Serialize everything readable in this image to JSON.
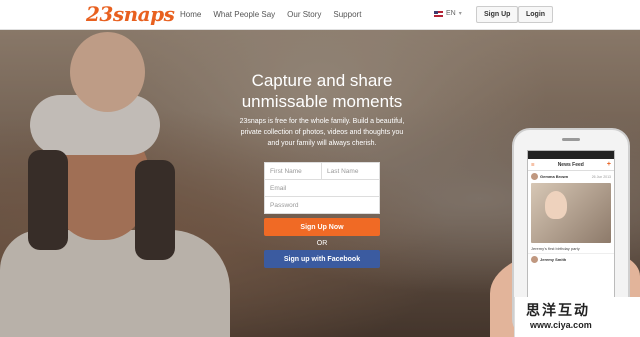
{
  "header": {
    "logo": "23snaps",
    "nav": [
      "Home",
      "What People Say",
      "Our Story",
      "Support"
    ],
    "language": "EN",
    "signup_label": "Sign Up",
    "login_label": "Login"
  },
  "hero": {
    "headline_1": "Capture and share",
    "headline_2": "unmissable moments",
    "subtext_1": "23snaps is free for the whole family. Build a beautiful,",
    "subtext_2": "private collection of photos, videos and thoughts you",
    "subtext_3": "and your family will always cherish."
  },
  "form": {
    "first_name_placeholder": "First Name",
    "last_name_placeholder": "Last Name",
    "email_placeholder": "Email",
    "password_placeholder": "Password",
    "signup_now_label": "Sign Up Now",
    "or_label": "OR",
    "facebook_label": "Sign up with Facebook"
  },
  "phone": {
    "status": "",
    "menu_label": "menu",
    "title": "News Feed",
    "post_author": "Gemma Brown",
    "post_date": "26 Jun 2013",
    "post_caption": "Jeremy's first birthday party",
    "comment_author": "Jeremy Smith"
  },
  "watermark": {
    "chinese": "思洋互动",
    "url": "www.ciya.com"
  },
  "colors": {
    "brand_orange": "#e8601f",
    "facebook_blue": "#3b5ba0"
  }
}
